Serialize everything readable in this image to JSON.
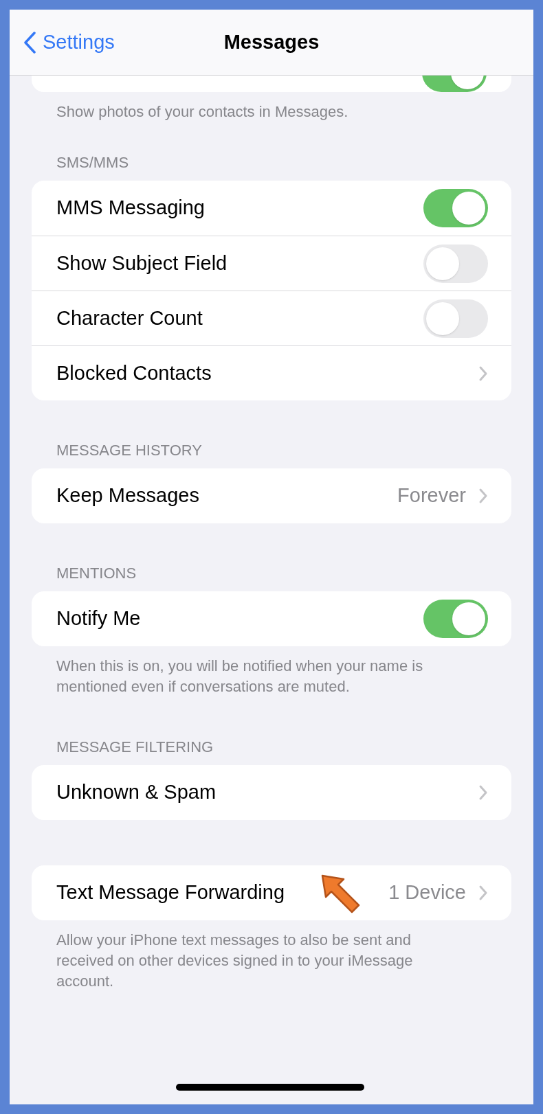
{
  "nav": {
    "back": "Settings",
    "title": "Messages"
  },
  "sections": [
    {
      "rows": [
        {
          "kind": "toggle",
          "on": true
        }
      ],
      "footer": "Show photos of your contacts in Messages.",
      "cut": true
    },
    {
      "header": "SMS/MMS",
      "rows": [
        {
          "kind": "toggle",
          "label": "MMS Messaging",
          "on": true
        },
        {
          "kind": "toggle",
          "label": "Show Subject Field",
          "on": false
        },
        {
          "kind": "toggle",
          "label": "Character Count",
          "on": false
        },
        {
          "kind": "link",
          "label": "Blocked Contacts"
        }
      ]
    },
    {
      "header": "MESSAGE HISTORY",
      "rows": [
        {
          "kind": "link",
          "label": "Keep Messages",
          "value": "Forever"
        }
      ]
    },
    {
      "header": "MENTIONS",
      "rows": [
        {
          "kind": "toggle",
          "label": "Notify Me",
          "on": true
        }
      ],
      "footer": "When this is on, you will be notified when your name is mentioned even if conversations are muted."
    },
    {
      "header": "MESSAGE FILTERING",
      "rows": [
        {
          "kind": "link",
          "label": "Unknown & Spam"
        }
      ]
    },
    {
      "rows": [
        {
          "kind": "link",
          "label": "Text Message Forwarding",
          "value": "1 Device",
          "pointer": true
        }
      ],
      "footer": "Allow your iPhone text messages to also be sent and received on other devices signed in to your iMessage account."
    }
  ]
}
